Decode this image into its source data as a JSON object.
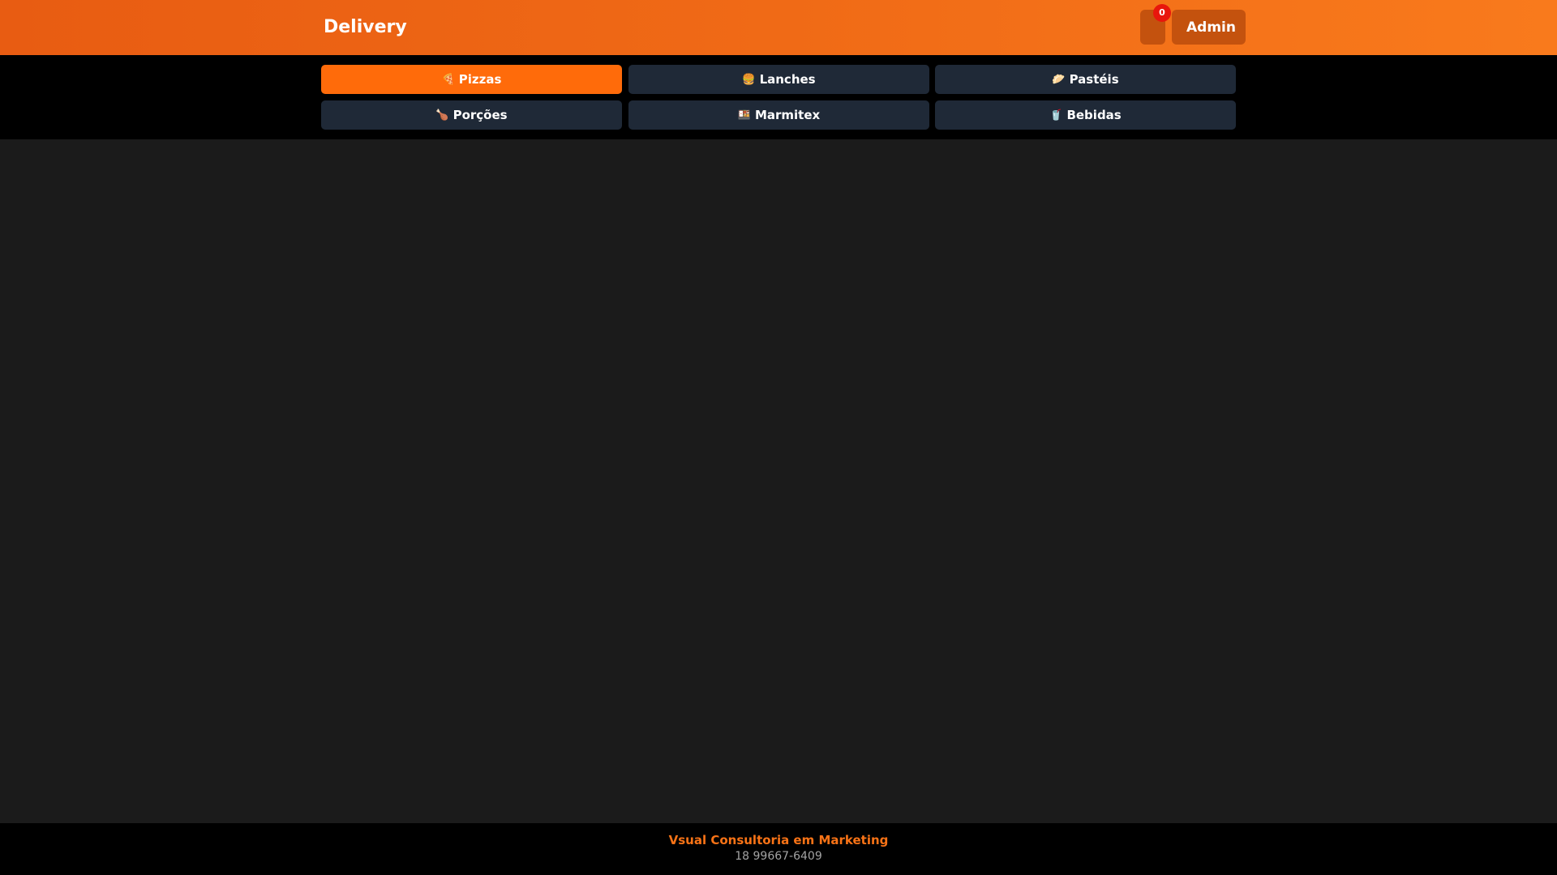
{
  "header": {
    "brand": "Delivery",
    "cart_count": "0",
    "admin_label": "Admin"
  },
  "categories": [
    {
      "icon": "🍕",
      "label": "Pizzas",
      "active": true
    },
    {
      "icon": "🍔",
      "label": "Lanches",
      "active": false
    },
    {
      "icon": "🥟",
      "label": "Pastéis",
      "active": false
    },
    {
      "icon": "🍗",
      "label": "Porções",
      "active": false
    },
    {
      "icon": "🍱",
      "label": "Marmitex",
      "active": false
    },
    {
      "icon": "🥤",
      "label": "Bebidas",
      "active": false
    }
  ],
  "footer": {
    "company": "Vsual Consultoria em Marketing",
    "phone": "18 99667-6409"
  },
  "colors": {
    "accent": "#ff6b0a",
    "header_gradient_start": "#e85c12",
    "header_gradient_end": "#f97a1c",
    "badge": "#e8160c",
    "category_bg": "#1f2937",
    "page_bg": "#1b1b1b"
  }
}
